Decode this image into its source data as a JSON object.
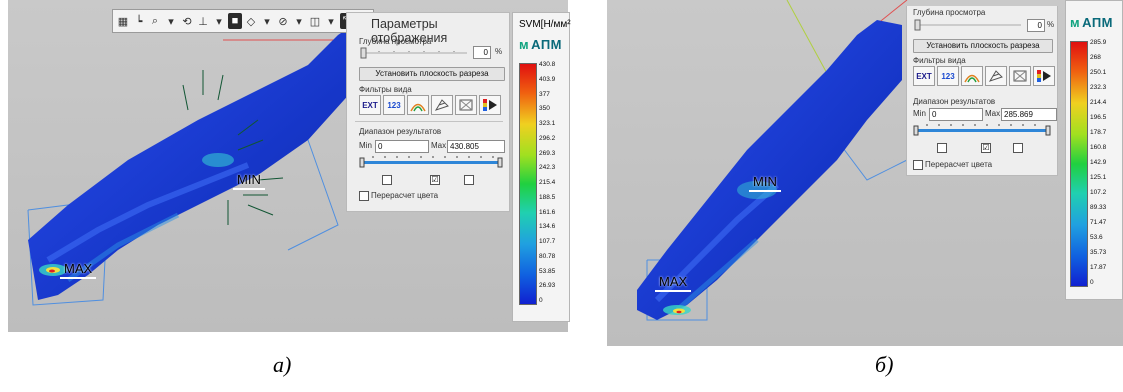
{
  "left": {
    "caption": "а)",
    "min_label": "MIN",
    "max_label": "MAX",
    "panel": {
      "title": "Параметры отображения",
      "depth_label": "Глубина просмотра",
      "depth_value": "0",
      "depth_unit": "%",
      "set_plane_button": "Установить плоскость разреза",
      "filters_label": "Фильтры вида",
      "filter_ext": "EXT",
      "filter_123": "123",
      "range_label": "Диапазон результатов",
      "min_label": "Min",
      "min_value": "0",
      "max_label": "Max",
      "max_value": "430.805",
      "checkboxes": [
        "",
        "☑",
        ""
      ],
      "recalc_label": "Перерасчет цвета"
    },
    "legend": {
      "unit": "SVM[Н/мм²",
      "brand": "АПМ",
      "ticks": [
        "430.8",
        "403.9",
        "377",
        "350",
        "323.1",
        "296.2",
        "269.3",
        "242.3",
        "215.4",
        "188.5",
        "161.6",
        "134.6",
        "107.7",
        "80.78",
        "53.85",
        "26.93",
        "0"
      ]
    }
  },
  "right": {
    "caption": "б)",
    "min_label": "MIN",
    "max_label": "MAX",
    "panel": {
      "depth_label": "Глубина просмотра",
      "depth_value": "0",
      "depth_unit": "%",
      "set_plane_button": "Установить плоскость разреза",
      "filters_label": "Фильтры вида",
      "filter_ext": "EXT",
      "filter_123": "123",
      "range_label": "Диапазон результатов",
      "min_label": "Min",
      "min_value": "0",
      "max_label": "Max",
      "max_value": "285.869",
      "checkboxes": [
        "",
        "☑",
        ""
      ],
      "recalc_label": "Перерасчет цвета"
    },
    "legend": {
      "brand": "АПМ",
      "ticks": [
        "285.9",
        "268",
        "250.1",
        "232.3",
        "214.4",
        "196.5",
        "178.7",
        "160.8",
        "142.9",
        "125.1",
        "107.2",
        "89.33",
        "71.47",
        "53.6",
        "35.73",
        "17.87",
        "0"
      ]
    }
  },
  "colors": {
    "part_blue": "#1a3fd6",
    "scene_bg": "#c4c4c4"
  }
}
